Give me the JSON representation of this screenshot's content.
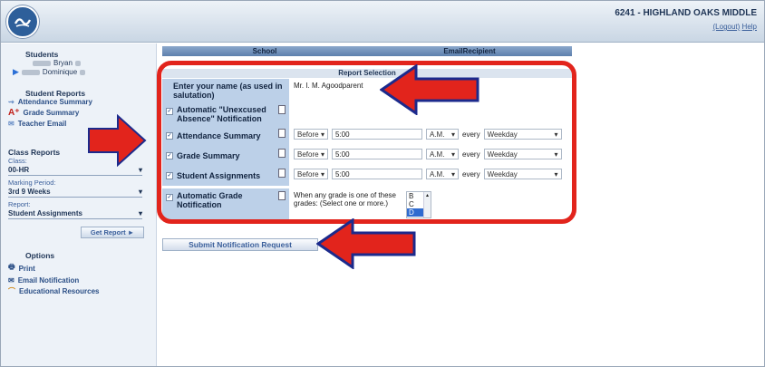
{
  "header": {
    "school": "6241 - HIGHLAND OAKS MIDDLE",
    "logout": "(Logout)",
    "help": "Help"
  },
  "sidebar": {
    "students_title": "Students",
    "students": [
      "Bryan",
      "Dominique"
    ],
    "reports_title": "Student Reports",
    "reports": [
      "Attendance Summary",
      "Grade Summary",
      "Teacher Email"
    ],
    "class_title": "Class Reports",
    "class_label": "Class:",
    "class_value": "00-HR",
    "period_label": "Marking Period:",
    "period_value": "3rd 9 Weeks",
    "report_label": "Report:",
    "report_value": "Student Assignments",
    "get_report": "Get Report ►",
    "options_title": "Options",
    "options": [
      "Print",
      "Email Notification",
      "Educational Resources"
    ]
  },
  "table": {
    "col_school": "School",
    "col_email": "EmailRecipient",
    "section_title": "Report Selection",
    "name_label": "Enter your name (as used in salutation)",
    "name_value": "Mr. I. M. Agoodparent",
    "unexcused_label": "Automatic \"Unexcused Absence\" Notification",
    "rows": [
      {
        "label": "Attendance Summary",
        "when": "Before",
        "time": "5:00",
        "ampm": "A.M.",
        "every": "every",
        "freq": "Weekday"
      },
      {
        "label": "Grade Summary",
        "when": "Before",
        "time": "5:00",
        "ampm": "A.M.",
        "every": "every",
        "freq": "Weekday"
      },
      {
        "label": "Student Assignments",
        "when": "Before",
        "time": "5:00",
        "ampm": "A.M.",
        "every": "every",
        "freq": "Weekday"
      }
    ],
    "grade_label": "Automatic Grade Notification",
    "grade_text": "When any grade is one of these grades: (Select one or more.)",
    "grades": [
      "B",
      "C",
      "D"
    ],
    "submit": "Submit Notification Request"
  },
  "colors": {
    "highlight": "#e2241c",
    "arrow_fill": "#e2241c",
    "arrow_edge": "#1c2a8c"
  }
}
